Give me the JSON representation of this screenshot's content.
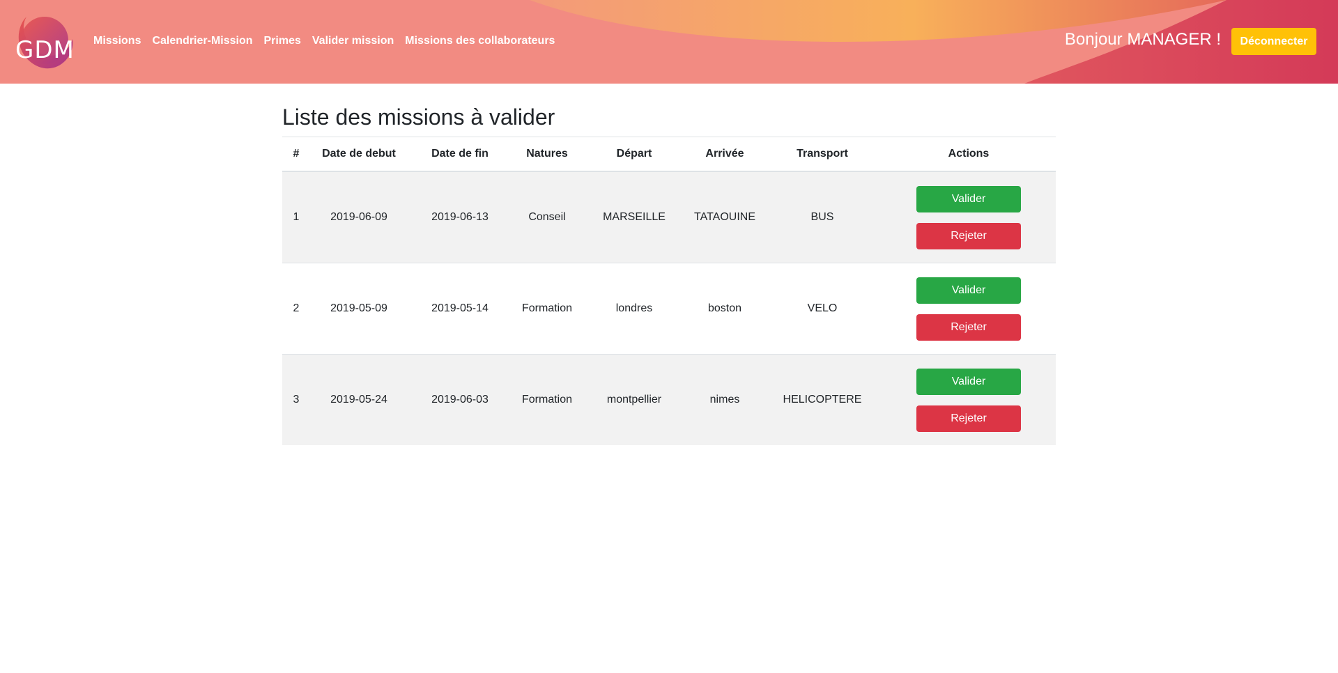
{
  "header": {
    "logo_text": "GDM",
    "nav": [
      {
        "label": "Missions"
      },
      {
        "label": "Calendrier-Mission"
      },
      {
        "label": "Primes"
      },
      {
        "label": "Valider mission"
      },
      {
        "label": "Missions des collaborateurs"
      }
    ],
    "greeting": "Bonjour MANAGER !",
    "logout_label": "Déconnecter"
  },
  "main": {
    "title": "Liste des missions à valider",
    "columns": [
      "#",
      "Date de debut",
      "Date de fin",
      "Natures",
      "Départ",
      "Arrivée",
      "Transport",
      "Actions"
    ],
    "rows": [
      {
        "num": "1",
        "debut": "2019-06-09",
        "fin": "2019-06-13",
        "nature": "Conseil",
        "depart": "MARSEILLE",
        "arrivee": "TATAOUINE",
        "transport": "BUS"
      },
      {
        "num": "2",
        "debut": "2019-05-09",
        "fin": "2019-05-14",
        "nature": "Formation",
        "depart": "londres",
        "arrivee": "boston",
        "transport": "VELO"
      },
      {
        "num": "3",
        "debut": "2019-05-24",
        "fin": "2019-06-03",
        "nature": "Formation",
        "depart": "montpellier",
        "arrivee": "nimes",
        "transport": "HELICOPTERE"
      }
    ],
    "valider_label": "Valider",
    "rejeter_label": "Rejeter"
  },
  "colors": {
    "header_coral": "#f28b82",
    "header_orange": "#f8b05a",
    "header_crimson": "#d8405a",
    "valider": "#28a745",
    "rejeter": "#dc3545",
    "logout": "#ffc107"
  }
}
